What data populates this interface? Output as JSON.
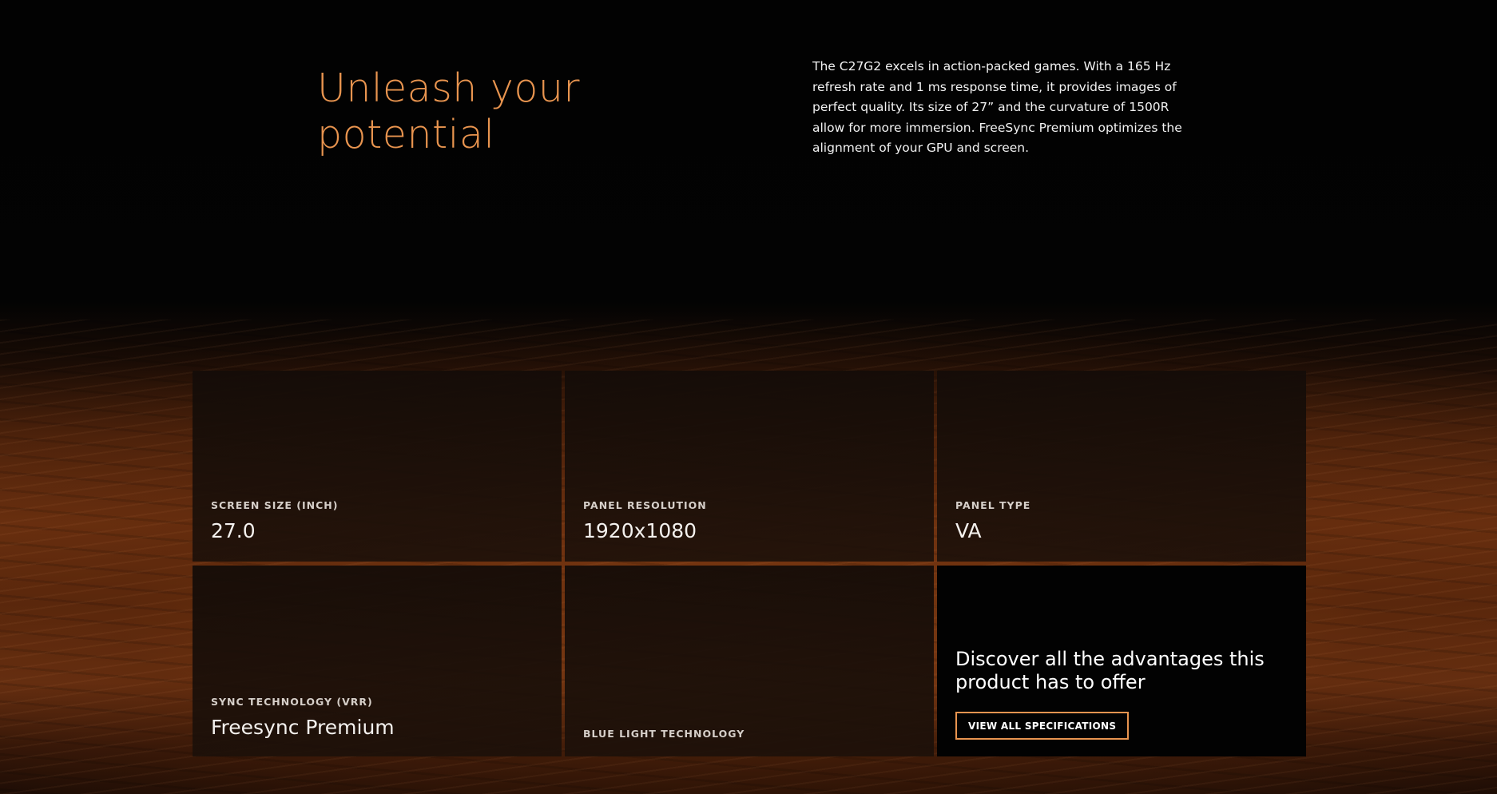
{
  "hero": {
    "headline_line1": "Unleash your",
    "headline_line2": "potential",
    "description": "The C27G2 excels in action-packed games. With a 165 Hz refresh rate and 1 ms response time, it provides images of perfect quality. Its size of 27” and the curvature of 1500R allow for more immersion. FreeSync Premium optimizes the alignment of your GPU and screen."
  },
  "specs": [
    {
      "label": "SCREEN SIZE (INCH)",
      "value": "27.0"
    },
    {
      "label": "PANEL RESOLUTION",
      "value": "1920x1080"
    },
    {
      "label": "PANEL TYPE",
      "value": "VA"
    },
    {
      "label": "SYNC TECHNOLOGY (VRR)",
      "value": "Freesync Premium"
    },
    {
      "label": "BLUE LIGHT TECHNOLOGY",
      "value": ""
    }
  ],
  "cta": {
    "title": "Discover all the advantages this product has to offer",
    "button_label": "VIEW ALL SPECIFICATIONS"
  },
  "colors": {
    "accent": "#e8944f",
    "background": "#030303",
    "tile": "#1a0f08"
  }
}
